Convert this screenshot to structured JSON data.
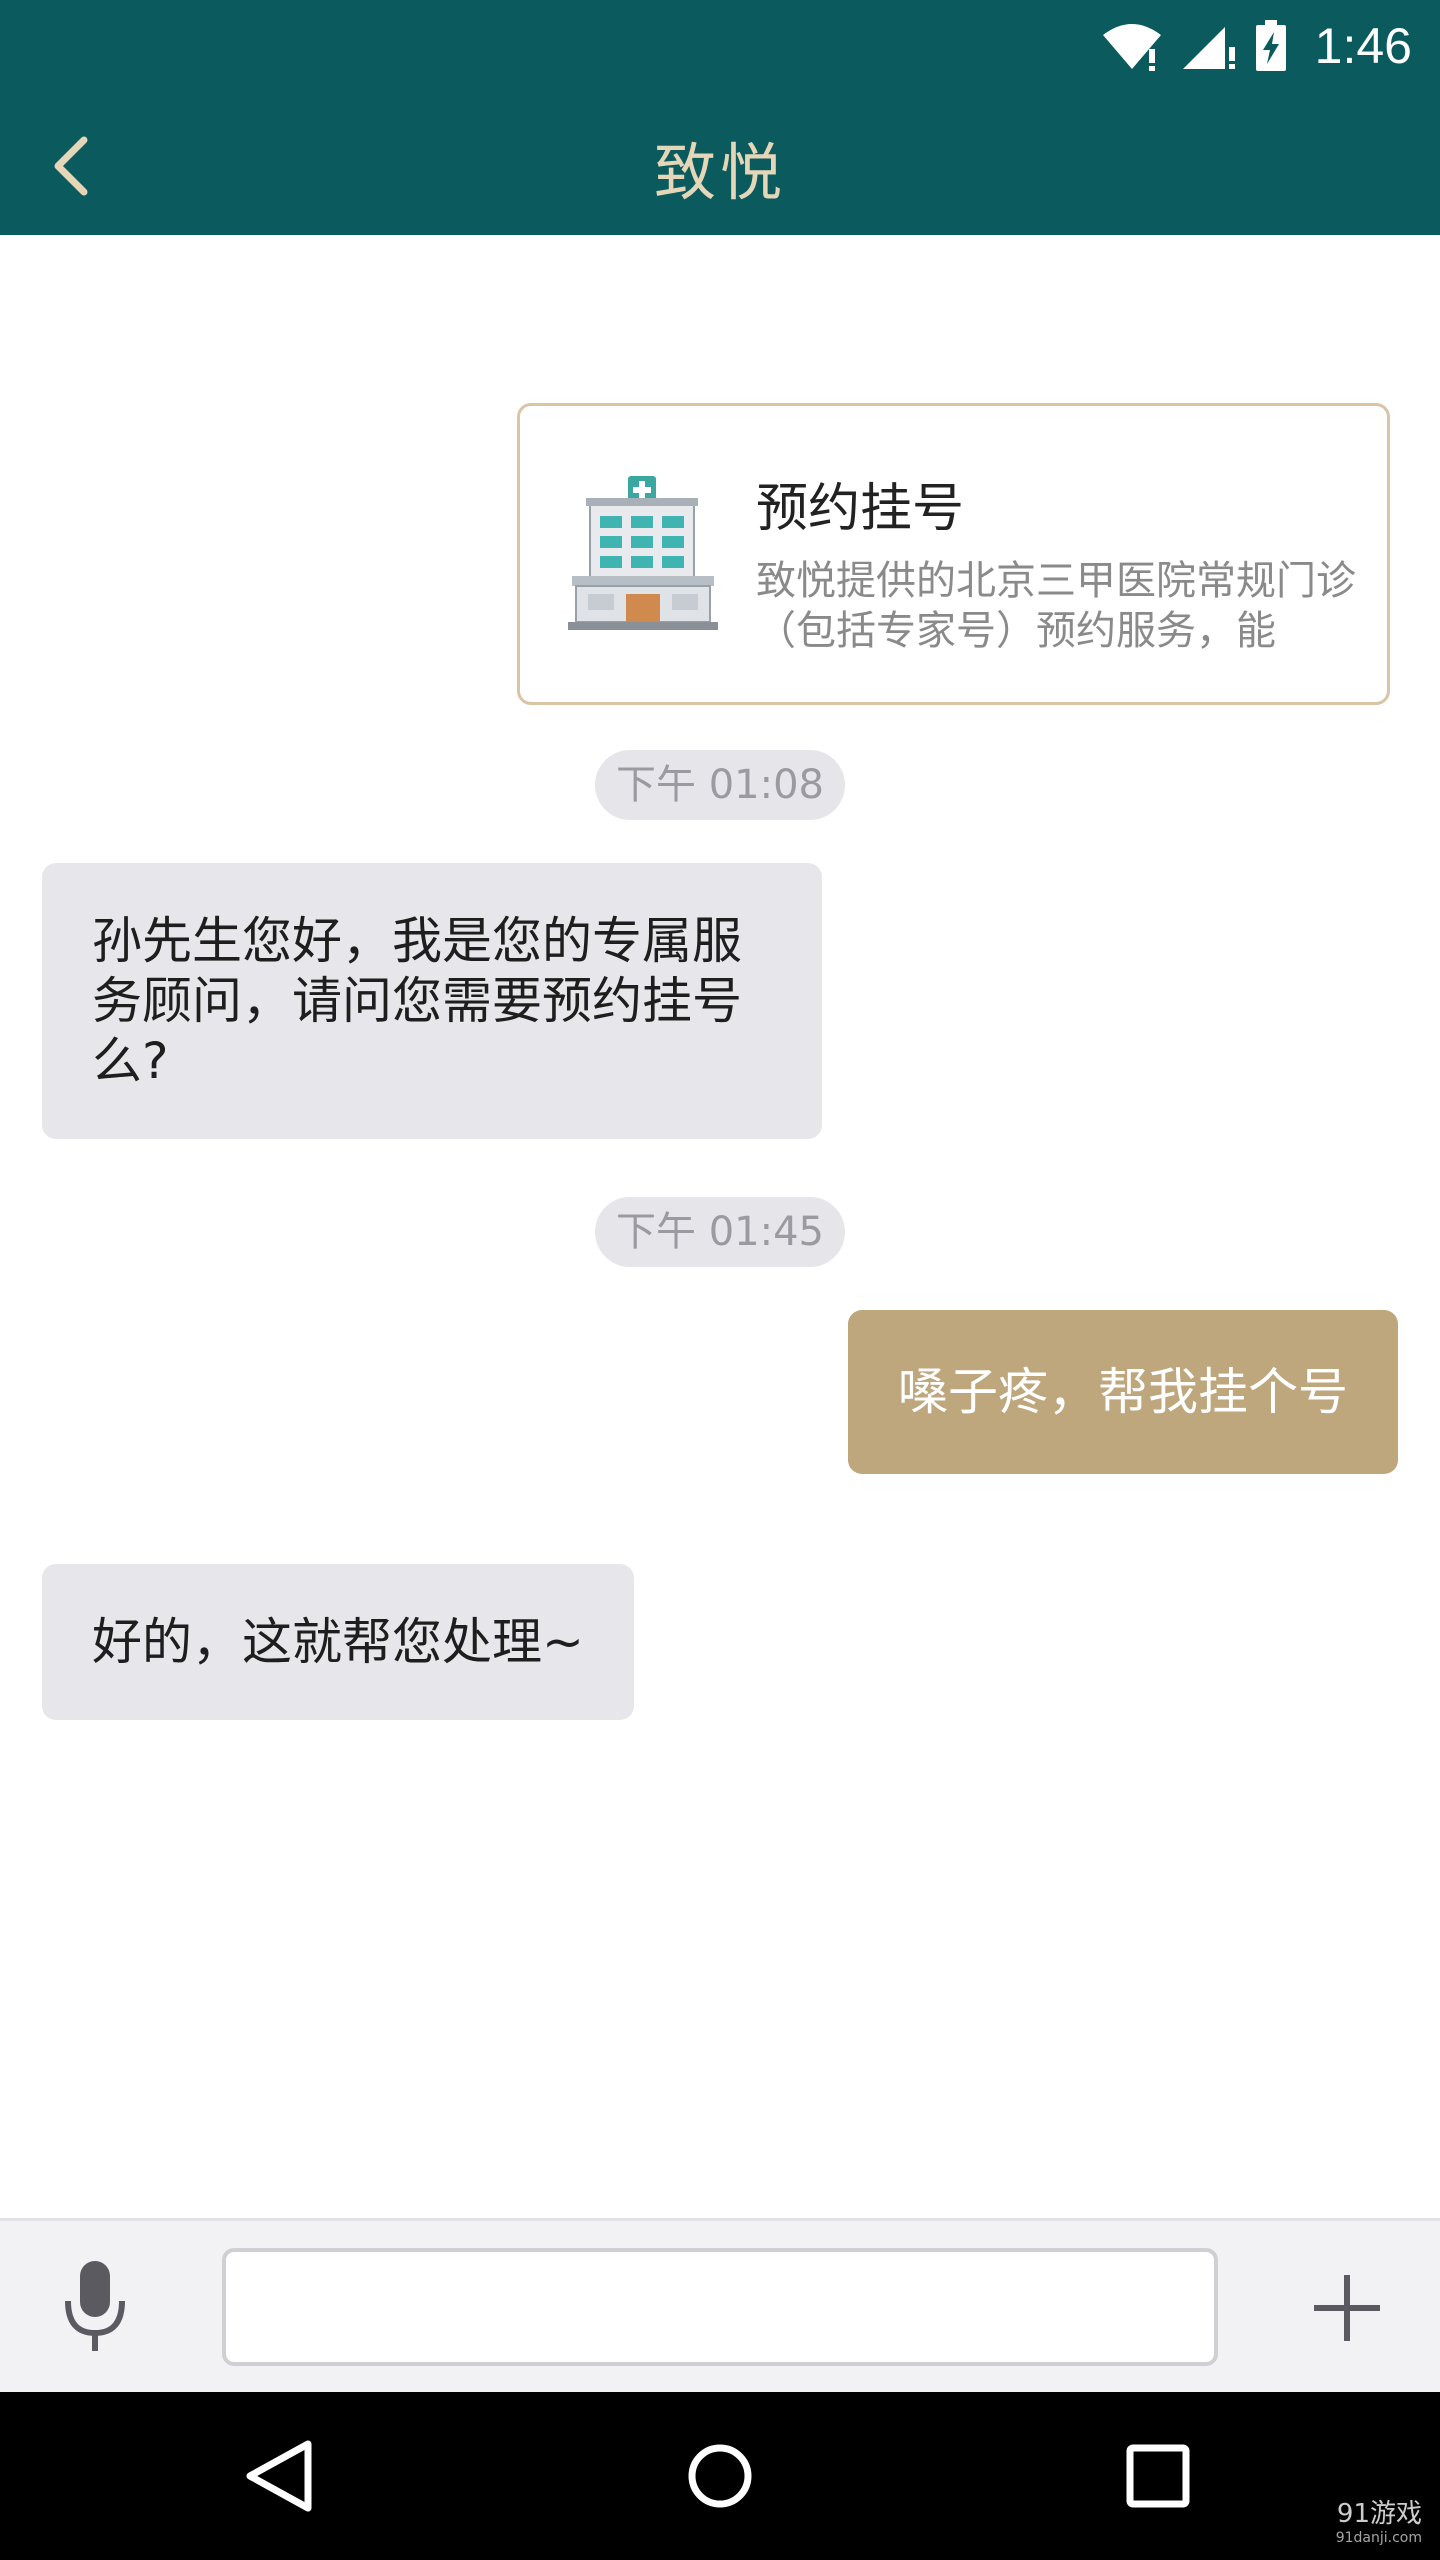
{
  "status_bar": {
    "time": "1:46"
  },
  "app_bar": {
    "title": "致悦"
  },
  "service_card": {
    "title": "预约挂号",
    "description": "致悦提供的北京三甲医院常规门诊（包括专家号）预约服务，能"
  },
  "messages": [
    {
      "type": "timestamp",
      "text": "下午 01:08"
    },
    {
      "type": "incoming",
      "text": "孙先生您好，我是您的专属服务顾问，请问您需要预约挂号么?"
    },
    {
      "type": "timestamp",
      "text": "下午 01:45"
    },
    {
      "type": "outgoing",
      "text": "嗓子疼，帮我挂个号"
    },
    {
      "type": "incoming",
      "text": "好的，这就帮您处理~"
    }
  ],
  "input": {
    "value": "",
    "placeholder": ""
  },
  "watermark": {
    "main": "91游戏",
    "sub": "91danji.com"
  },
  "colors": {
    "app_bar": "#0a5a5e",
    "title": "#e6d6b8",
    "outgoing_bubble": "#bea67d",
    "incoming_bubble": "#e7e7eb",
    "card_border": "#d9c4a5"
  },
  "icons": [
    "wifi-icon",
    "signal-icon",
    "battery-icon",
    "back-icon",
    "hospital-icon",
    "microphone-icon",
    "plus-icon",
    "nav-back-icon",
    "nav-home-icon",
    "nav-recents-icon"
  ]
}
